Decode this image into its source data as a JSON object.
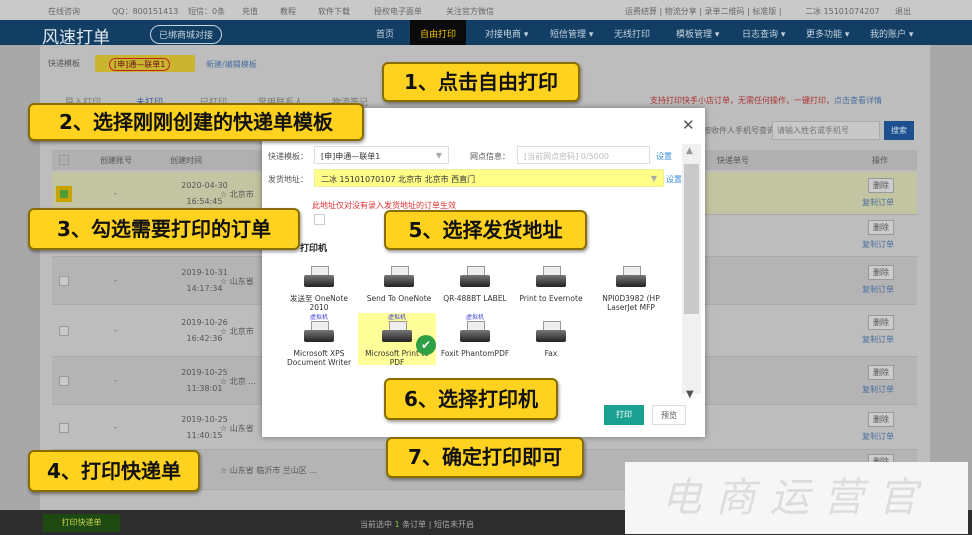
{
  "topbar": {
    "online": "在线咨询",
    "qq": "QQ：800151413",
    "sms": "短信：0条",
    "recharge": "充值",
    "tutorial": "教程",
    "client": "软件下载",
    "auth": "授权电子面单",
    "follow": "关注官方微信",
    "right": "运费结算 | 物流分享 | 录单二维码 | 标准版 |",
    "user": "二冰 15101074207",
    "logout": "退出"
  },
  "nav": {
    "logo": "风速打单",
    "shop_button": "已绑商城对接",
    "items": [
      "首页",
      "自由打印",
      "对接电商 ▾",
      "短信管理 ▾",
      "无线打印",
      "模板管理 ▾",
      "日志查询 ▾",
      "更多功能 ▾",
      "我的账户 ▾"
    ]
  },
  "toolbar": {
    "template_label": "快递模板",
    "template_chip": "[申]通—联单1",
    "new_template": "新建/编辑模板"
  },
  "notice": {
    "text": "支持打印快手小店订单，无需任何操作，一键打印，",
    "link": "点击查看详情"
  },
  "tabs": [
    "导入打印",
    "未打印",
    "已打印",
    "常用联系人",
    "物流签记"
  ],
  "search": {
    "select": "按收件人手机号查询",
    "placeholder": "请输入姓名或手机号",
    "button": "搜索"
  },
  "table": {
    "headers": [
      "创建账号",
      "创建时间",
      "快递单号",
      "操作"
    ],
    "rows": [
      {
        "account": "-",
        "date": "2020-04-30",
        "time": "16:54:45",
        "addr": "北京市",
        "selected": true
      },
      {
        "account": "",
        "date": "",
        "time": "",
        "addr": "",
        "selected": false
      },
      {
        "account": "-",
        "date": "2019-10-31",
        "time": "14:17:34",
        "addr": "山东省",
        "selected": false
      },
      {
        "account": "-",
        "date": "2019-10-26",
        "time": "16:42:36",
        "addr": "北京市",
        "selected": false
      },
      {
        "account": "-",
        "date": "2019-10-25",
        "time": "11:38:01",
        "addr": "北京 ...",
        "selected": false
      },
      {
        "account": "-",
        "date": "2019-10-25",
        "time": "11:40:15",
        "addr": "山东省",
        "selected": false
      },
      {
        "account": "",
        "date": "",
        "time": "",
        "addr": "山东省 临沂市 兰山区 ...",
        "selected": false
      }
    ],
    "delete_label": "删除",
    "copy_label": "复制订单"
  },
  "bottom": {
    "print_button": "打印快递单",
    "status_prefix": "当前选中",
    "count": "1",
    "status_suffix": "条订单 | 短信未开启"
  },
  "modal": {
    "template_label": "快递模板：",
    "template_value": "[申]申通—联单1",
    "network_label": "网点信息：",
    "network_value": "[当前网点密码] 0/5000",
    "set1": "设置",
    "address_label": "发货地址：",
    "address_value": "二冰 15101070107 北京市 北京市 西直门",
    "set2": "设置",
    "warning": "此地址仅对没有录入发货地址的订单生效",
    "printer_title": "打印机",
    "printers": [
      {
        "name": "发送至 OneNote 2010",
        "virtual": ""
      },
      {
        "name": "Send To OneNote",
        "virtual": ""
      },
      {
        "name": "QR-488BT LABEL",
        "virtual": ""
      },
      {
        "name": "Print to Evernote",
        "virtual": ""
      },
      {
        "name": "NPI0D3982 (HP LaserJet MFP",
        "virtual": ""
      },
      {
        "name": "Microsoft XPS Document Writer",
        "virtual": "虚拟机"
      },
      {
        "name": "Microsoft Print to PDF",
        "virtual": "虚拟机",
        "selected": true
      },
      {
        "name": "Foxit PhantomPDF",
        "virtual": "虚拟机"
      },
      {
        "name": "Fax",
        "virtual": ""
      }
    ],
    "print_button": "打印",
    "preview_button": "预览"
  },
  "callouts": [
    "1、点击自由打印",
    "2、选择刚刚创建的快递单模板",
    "3、勾选需要打印的订单",
    "4、打印快递单",
    "5、选择发货地址",
    "6、选择打印机",
    "7、确定打印即可"
  ],
  "watermark": "电商运营官",
  "colors": {
    "nav": "#123e63",
    "callout": "#ffd21f",
    "print_button": "#1aa191",
    "bottom_print": "#1e4a12"
  }
}
